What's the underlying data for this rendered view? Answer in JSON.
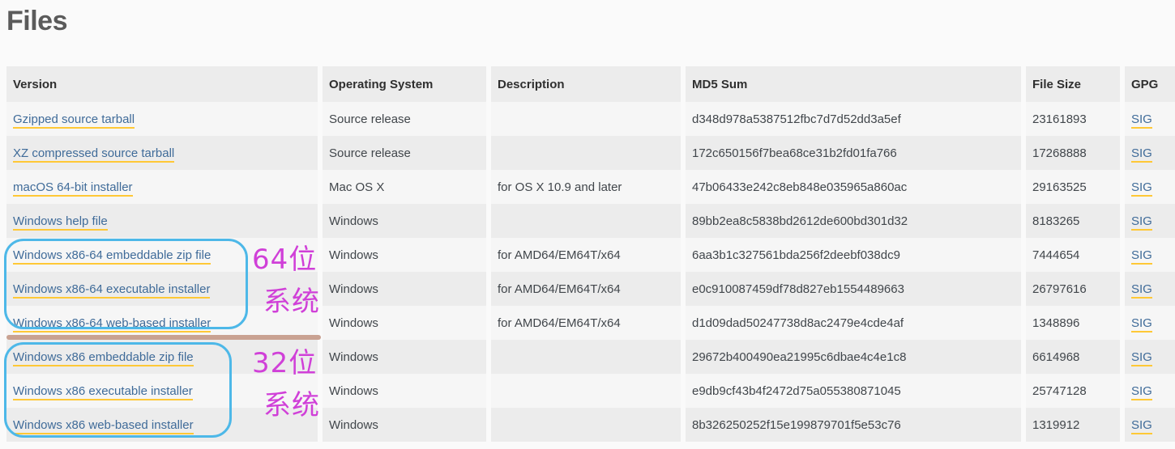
{
  "page": {
    "title": "Files"
  },
  "table": {
    "columns": [
      {
        "key": "version",
        "label": "Version"
      },
      {
        "key": "os",
        "label": "Operating System"
      },
      {
        "key": "description",
        "label": "Description"
      },
      {
        "key": "md5",
        "label": "MD5 Sum"
      },
      {
        "key": "filesize",
        "label": "File Size"
      },
      {
        "key": "gpg",
        "label": "GPG"
      }
    ],
    "rows": [
      {
        "version": "Gzipped source tarball",
        "os": "Source release",
        "description": "",
        "md5": "d348d978a5387512fbc7d7d52dd3a5ef",
        "filesize": "23161893",
        "gpg": "SIG"
      },
      {
        "version": "XZ compressed source tarball",
        "os": "Source release",
        "description": "",
        "md5": "172c650156f7bea68ce31b2fd01fa766",
        "filesize": "17268888",
        "gpg": "SIG"
      },
      {
        "version": "macOS 64-bit installer",
        "os": "Mac OS X",
        "description": "for OS X 10.9 and later",
        "md5": "47b06433e242c8eb848e035965a860ac",
        "filesize": "29163525",
        "gpg": "SIG"
      },
      {
        "version": "Windows help file",
        "os": "Windows",
        "description": "",
        "md5": "89bb2ea8c5838bd2612de600bd301d32",
        "filesize": "8183265",
        "gpg": "SIG"
      },
      {
        "version": "Windows x86-64 embeddable zip file",
        "os": "Windows",
        "description": "for AMD64/EM64T/x64",
        "md5": "6aa3b1c327561bda256f2deebf038dc9",
        "filesize": "7444654",
        "gpg": "SIG"
      },
      {
        "version": "Windows x86-64 executable installer",
        "os": "Windows",
        "description": "for AMD64/EM64T/x64",
        "md5": "e0c910087459df78d827eb1554489663",
        "filesize": "26797616",
        "gpg": "SIG"
      },
      {
        "version": "Windows x86-64 web-based installer",
        "os": "Windows",
        "description": "for AMD64/EM64T/x64",
        "md5": "d1d09dad50247738d8ac2479e4cde4af",
        "filesize": "1348896",
        "gpg": "SIG"
      },
      {
        "version": "Windows x86 embeddable zip file",
        "os": "Windows",
        "description": "",
        "md5": "29672b400490ea21995c6dbae4c4e1c8",
        "filesize": "6614968",
        "gpg": "SIG"
      },
      {
        "version": "Windows x86 executable installer",
        "os": "Windows",
        "description": "",
        "md5": "e9db9cf43b4f2472d75a055380871045",
        "filesize": "25747128",
        "gpg": "SIG"
      },
      {
        "version": "Windows x86 web-based installer",
        "os": "Windows",
        "description": "",
        "md5": "8b326250252f15e199879701f5e53c76",
        "filesize": "1319912",
        "gpg": "SIG"
      }
    ]
  },
  "annotations": {
    "box_64_color": "#4db8e8",
    "box_32_color": "#4db8e8",
    "divider_color": "#c9a292",
    "text_color": "#d040d8",
    "label_64_line1": "64位",
    "label_64_line2": "系统",
    "label_32_line1": "32位",
    "label_32_line2": "系统"
  },
  "colors": {
    "link": "#3f6b99",
    "link_underline": "#ffc836",
    "header_bg": "#ececec",
    "row_odd": "#f6f6f6",
    "row_even": "#ececec",
    "page_bg": "#fafafa",
    "title": "#5b5b5b"
  }
}
